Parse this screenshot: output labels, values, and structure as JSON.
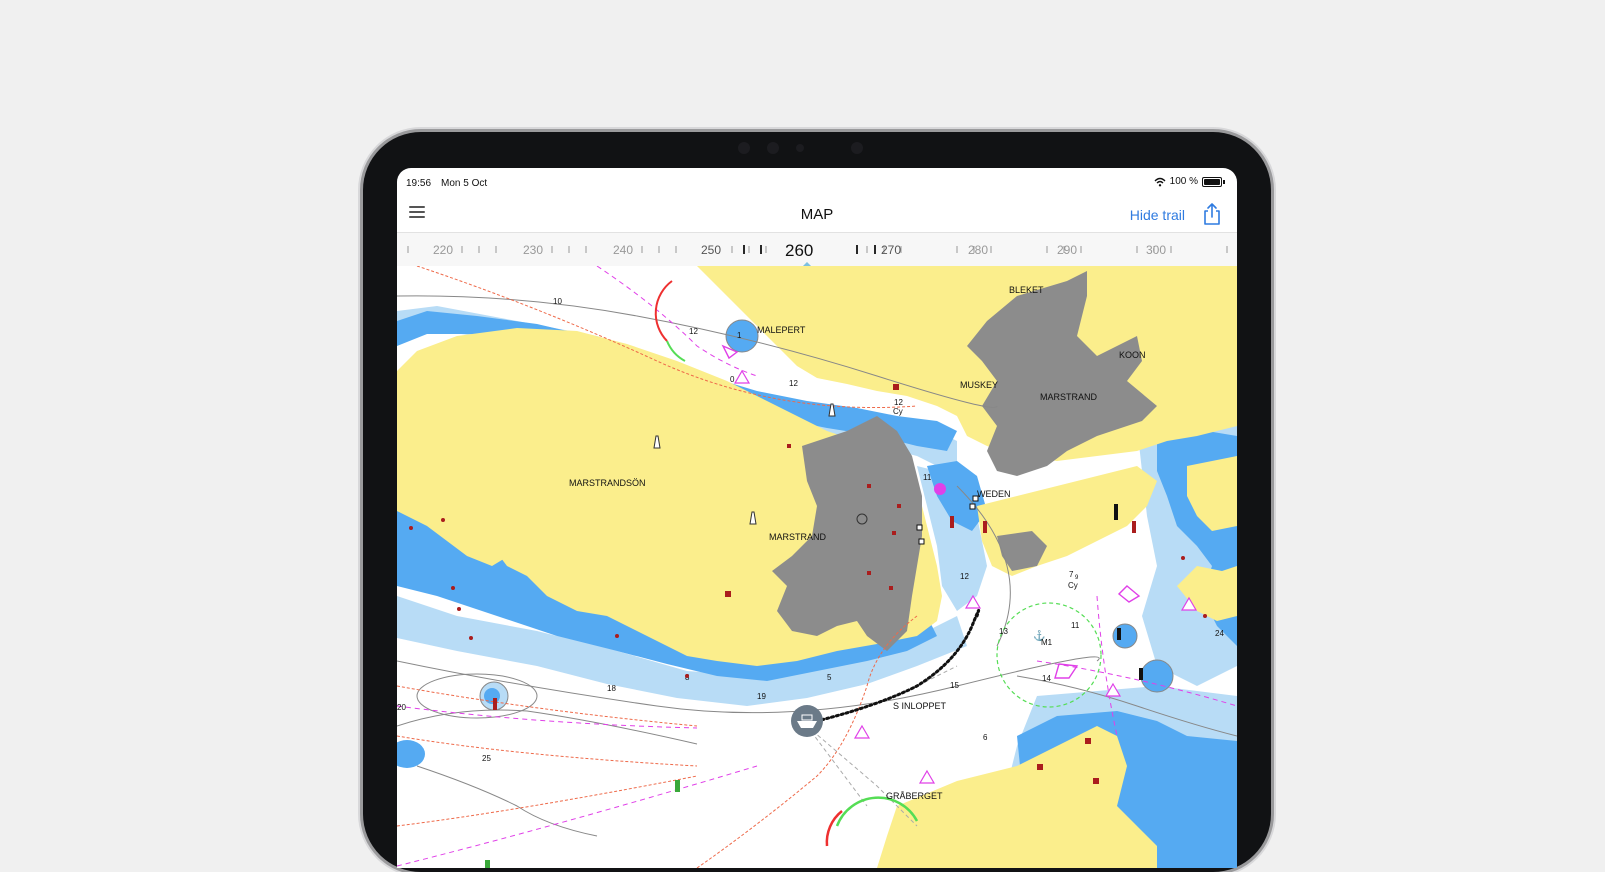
{
  "status": {
    "time": "19:56",
    "date": "Mon 5 Oct",
    "battery": "100 %"
  },
  "nav": {
    "title": "MAP",
    "hide_trail_label": "Hide trail",
    "menu_icon": "hamburger-icon",
    "share_icon": "share-icon"
  },
  "compass": {
    "heading": "260",
    "ticks": [
      "220",
      "230",
      "240",
      "250",
      "270",
      "280",
      "290",
      "300"
    ]
  },
  "map": {
    "places": {
      "bleket": "BLEKET",
      "malepert": "MALEPERT",
      "koon": "KOON",
      "muskey": "MUSKEY",
      "marstrand_ne": "MARSTRAND",
      "marstrandson": "MARSTRANDSÖN",
      "marstrand": "MARSTRAND",
      "weden": "WEDEN",
      "s_inloppet": "S INLOPPET",
      "graberget": "GRÅBERGET"
    },
    "depths": {
      "d10": "10",
      "d12a": "12",
      "d1": "1",
      "d0": "0",
      "d12b": "12",
      "d12c": "12",
      "cy1": "Cy",
      "d11a": "11",
      "d12d": "12",
      "d7": "7",
      "d9": "9",
      "cy2": "Cy",
      "d13": "13",
      "d11b": "11",
      "m1": "M1",
      "d14": "14",
      "d15": "15",
      "d18": "18",
      "d19": "19",
      "d25": "25",
      "d20": "20",
      "d6": "6",
      "d24": "24",
      "d8": "8",
      "d5": "5"
    },
    "colors": {
      "land": "#fbee8c",
      "shallow": "#55aaf2",
      "light_water": "#b8dcf6",
      "built_area": "#8c8c8c",
      "magenta": "#e040e8",
      "red_line": "#ee6a4a"
    }
  }
}
